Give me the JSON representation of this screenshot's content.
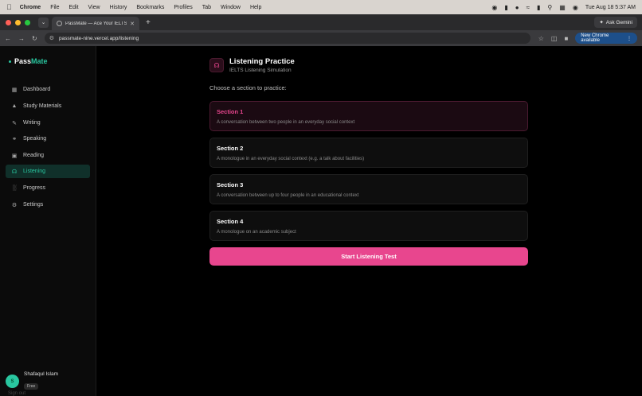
{
  "menubar": {
    "app": "Chrome",
    "items": [
      "File",
      "Edit",
      "View",
      "History",
      "Bookmarks",
      "Profiles",
      "Tab",
      "Window",
      "Help"
    ],
    "clock": "Tue Aug 18  5:37 AM"
  },
  "browser": {
    "tab_title": "PassMate — Ace Your IELTS …",
    "ask_gemini": "Ask Gemini",
    "url": "passmate-nine.vercel.app/listening",
    "update_label": "New Chrome available"
  },
  "sidebar": {
    "logo_prefix": "Pass",
    "logo_accent": "Mate",
    "items": [
      {
        "label": "Dashboard",
        "icon": "grid-icon"
      },
      {
        "label": "Study Materials",
        "icon": "graduation-cap-icon"
      },
      {
        "label": "Writing",
        "icon": "pen-icon"
      },
      {
        "label": "Speaking",
        "icon": "microphone-icon"
      },
      {
        "label": "Reading",
        "icon": "book-icon"
      },
      {
        "label": "Listening",
        "icon": "headphones-icon"
      },
      {
        "label": "Progress",
        "icon": "bar-chart-icon"
      },
      {
        "label": "Settings",
        "icon": "gear-icon"
      }
    ],
    "active": "Listening",
    "user": {
      "initial": "S",
      "name": "Shafaqul Islam",
      "plan": "Free"
    },
    "signout": "Sign out"
  },
  "main": {
    "title": "Listening Practice",
    "subtitle": "IELTS Listening Simulation",
    "prompt": "Choose a section to practice:",
    "sections": [
      {
        "name": "Section 1",
        "desc": "A conversation between two people in an everyday social context"
      },
      {
        "name": "Section 2",
        "desc": "A monologue in an everyday social context (e.g. a talk about facilities)"
      },
      {
        "name": "Section 3",
        "desc": "A conversation between up to four people in an educational context"
      },
      {
        "name": "Section 4",
        "desc": "A monologue on an academic subject"
      }
    ],
    "selected_section": "Section 1",
    "start_button": "Start Listening Test"
  },
  "colors": {
    "accent_pink": "#e8468e",
    "accent_teal": "#29c7a0",
    "background": "#000000"
  }
}
